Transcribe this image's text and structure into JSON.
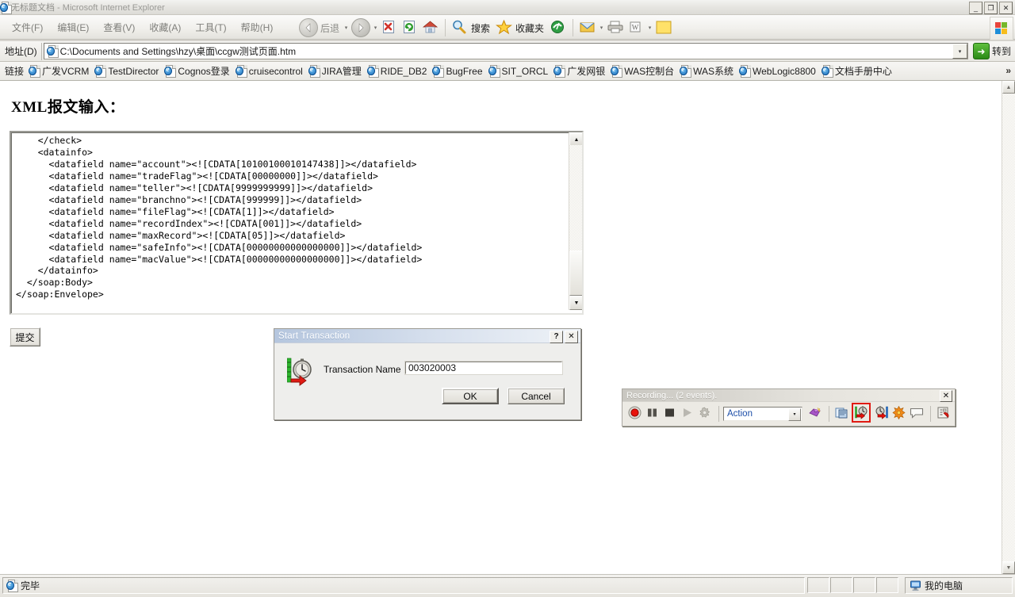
{
  "window": {
    "title_doc": "无标题文档",
    "title_app": " - Microsoft Internet Explorer",
    "minimize": "_",
    "maximize": "❐",
    "close": "✕"
  },
  "menu": {
    "items": [
      {
        "label": "文件(F)",
        "accel": "F"
      },
      {
        "label": "编辑(E)",
        "accel": "E"
      },
      {
        "label": "查看(V)",
        "accel": "V"
      },
      {
        "label": "收藏(A)",
        "accel": "A"
      },
      {
        "label": "工具(T)",
        "accel": "T"
      },
      {
        "label": "帮助(H)",
        "accel": "H"
      }
    ]
  },
  "toolbar": {
    "back_label": "后退",
    "forward_label": "",
    "stop_icon": "stop-icon",
    "refresh_icon": "refresh-icon",
    "home_icon": "home-icon",
    "search_label": "搜索",
    "favorites_label": "收藏夹",
    "media_icon": "media-icon",
    "mail_icon": "mail-icon",
    "print_icon": "print-icon",
    "edit_icon": "edit-word-icon",
    "messenger_icon": "messenger-icon",
    "dropdown_arrow": "▾"
  },
  "address": {
    "label": "地址(D)",
    "value": "C:\\Documents and Settings\\hzy\\桌面\\ccgw测试页面.htm",
    "go_label": "转到",
    "go_arrow": "➜",
    "dropdown_arrow": "▾"
  },
  "links": {
    "label": "链接",
    "items": [
      {
        "label": "广发VCRM"
      },
      {
        "label": "TestDirector"
      },
      {
        "label": "Cognos登录"
      },
      {
        "label": "cruisecontrol"
      },
      {
        "label": "JIRA管理"
      },
      {
        "label": "RIDE_DB2"
      },
      {
        "label": "BugFree"
      },
      {
        "label": "SIT_ORCL"
      },
      {
        "label": "广发网银"
      },
      {
        "label": "WAS控制台"
      },
      {
        "label": "WAS系统"
      },
      {
        "label": "WebLogic8800"
      },
      {
        "label": "文档手册中心"
      }
    ],
    "overflow": "»"
  },
  "page": {
    "heading": "XML报文输入：",
    "xml_content": "    </check>\n    <datainfo>\n      <datafield name=\"account\"><![CDATA[10100100010147438]]></datafield>\n      <datafield name=\"tradeFlag\"><![CDATA[00000000]]></datafield>\n      <datafield name=\"teller\"><![CDATA[9999999999]]></datafield>\n      <datafield name=\"branchno\"><![CDATA[999999]]></datafield>\n      <datafield name=\"fileFlag\"><![CDATA[1]]></datafield>\n      <datafield name=\"recordIndex\"><![CDATA[001]]></datafield>\n      <datafield name=\"maxRecord\"><![CDATA[05]]></datafield>\n      <datafield name=\"safeInfo\"><![CDATA[00000000000000000]]></datafield>\n      <datafield name=\"macValue\"><![CDATA[00000000000000000]]></datafield>\n    </datainfo>\n  </soap:Body>\n</soap:Envelope>",
    "submit_label": "提交",
    "scroll_up": "▲",
    "scroll_down": "▼"
  },
  "dialog": {
    "title": "Start Transaction",
    "help_btn": "?",
    "close_btn": "✕",
    "field_label": "Transaction Name :",
    "field_value": "003020003",
    "ok_label": "OK",
    "cancel_label": "Cancel"
  },
  "recording": {
    "title": "Recording... (2 events).",
    "close_btn": "✕",
    "buttons": [
      {
        "name": "record-button",
        "icon": "record-icon"
      },
      {
        "name": "pause-button",
        "icon": "pause-icon"
      },
      {
        "name": "stop-button",
        "icon": "stop-icon"
      },
      {
        "name": "play-button",
        "icon": "play-icon"
      },
      {
        "name": "settings-button",
        "icon": "gear-icon"
      }
    ],
    "combo_value": "Action",
    "combo_arrow": "▾",
    "tool_buttons": [
      {
        "name": "new-action-button",
        "icon": "new-action-icon"
      },
      {
        "name": "insert-step-button",
        "icon": "binoculars-icon"
      },
      {
        "name": "start-transaction-button",
        "icon": "start-transaction-icon",
        "highlighted": true
      },
      {
        "name": "end-transaction-button",
        "icon": "end-transaction-icon"
      },
      {
        "name": "rendezvous-button",
        "icon": "rendezvous-icon"
      },
      {
        "name": "comment-button",
        "icon": "comment-icon"
      },
      {
        "name": "properties-button",
        "icon": "properties-icon"
      }
    ],
    "highlight_color": "#e01b13"
  },
  "status": {
    "text": "完毕",
    "zone": "我的电脑"
  }
}
